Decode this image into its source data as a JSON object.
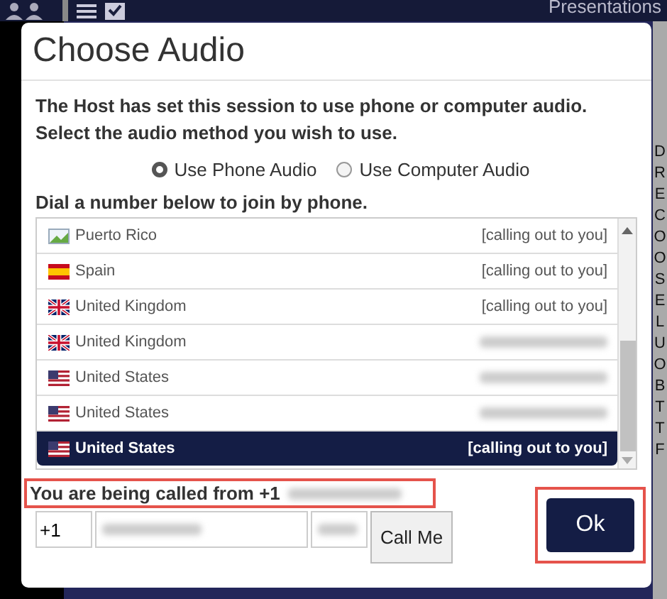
{
  "top_bar": {
    "title": "Presentations"
  },
  "side_letters": [
    "D",
    "R",
    "E",
    "C",
    "O",
    "O",
    "S",
    "E",
    "L",
    "U",
    "O",
    "B",
    "T",
    "T",
    "F"
  ],
  "dialog": {
    "title": "Choose Audio",
    "message": "The Host has set this session to use phone or computer audio.\nSelect the audio method you wish to use.",
    "audio_options": [
      {
        "label": "Use Phone Audio",
        "selected": true
      },
      {
        "label": "Use Computer Audio",
        "selected": false
      }
    ],
    "dial_heading": "Dial a number below to join by phone.",
    "numbers": [
      {
        "kind": "broken",
        "country": "Puerto Rico",
        "detail": "[calling out to you]",
        "selected": false
      },
      {
        "kind": "es",
        "country": "Spain",
        "detail": "[calling out to you]",
        "selected": false
      },
      {
        "kind": "gb",
        "country": "United Kingdom",
        "detail": "[calling out to you]",
        "selected": false
      },
      {
        "kind": "gb",
        "country": "United Kingdom",
        "blurred": true,
        "selected": false
      },
      {
        "kind": "us",
        "country": "United States",
        "blurred": true,
        "selected": false
      },
      {
        "kind": "us",
        "country": "United States",
        "blurred": true,
        "selected": false
      },
      {
        "kind": "us",
        "country": "United States",
        "detail": "[calling out to you]",
        "selected": true
      }
    ],
    "calling_notice": "You are being called from +1",
    "country_code": "+1",
    "call_button": "Call Me",
    "ok_button": "Ok"
  }
}
